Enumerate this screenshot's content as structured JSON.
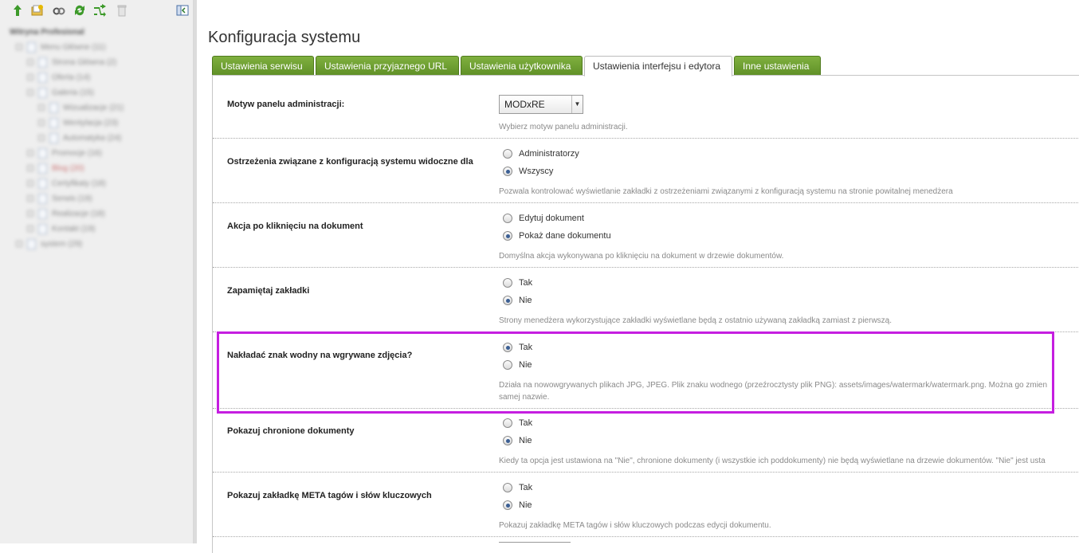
{
  "sidebar": {
    "toolbar_icons": [
      "arrow-up-icon",
      "new-folder-icon",
      "link-icon",
      "refresh-icon",
      "shuffle-icon",
      "trash-icon",
      "collapse-panel-icon"
    ],
    "tree": [
      {
        "label": "Witryna Profesional",
        "level": 0,
        "root": true
      },
      {
        "label": "Menu Główne (11)",
        "level": 1
      },
      {
        "label": "Strona Główna (2)",
        "level": 2
      },
      {
        "label": "Oferta (14)",
        "level": 2
      },
      {
        "label": "Galeria (15)",
        "level": 2
      },
      {
        "label": "Wizualizacje (21)",
        "level": 3
      },
      {
        "label": "Wentylacja (23)",
        "level": 3
      },
      {
        "label": "Automatyka (24)",
        "level": 3
      },
      {
        "label": "Promocje (16)",
        "level": 2
      },
      {
        "label": "Blog (20)",
        "level": 2,
        "red": true
      },
      {
        "label": "Certyfikaty (18)",
        "level": 2
      },
      {
        "label": "Serwis (19)",
        "level": 2
      },
      {
        "label": "Realizacje (18)",
        "level": 2
      },
      {
        "label": "Kontakt (19)",
        "level": 2
      },
      {
        "label": "system (29)",
        "level": 1
      }
    ]
  },
  "page": {
    "title": "Konfiguracja systemu"
  },
  "tabs": [
    {
      "label": "Ustawienia serwisu",
      "active": false
    },
    {
      "label": "Ustawienia przyjaznego URL",
      "active": false
    },
    {
      "label": "Ustawienia użytkownika",
      "active": false
    },
    {
      "label": "Ustawienia interfejsu i edytora",
      "active": true
    },
    {
      "label": "Inne ustawienia",
      "active": false
    }
  ],
  "settings": {
    "theme": {
      "label": "Motyw panelu administracji:",
      "selected": "MODxRE",
      "description": "Wybierz motyw panelu administracji."
    },
    "warnings": {
      "label": "Ostrzeżenia związane z konfiguracją systemu widoczne dla",
      "options": [
        {
          "label": "Administratorzy",
          "checked": false
        },
        {
          "label": "Wszyscy",
          "checked": true
        }
      ],
      "description": "Pozwala kontrolować wyświetlanie zakładki z ostrzeżeniami związanymi z konfiguracją systemu na stronie powitalnej menedżera"
    },
    "doc_click": {
      "label": "Akcja po kliknięciu na dokument",
      "options": [
        {
          "label": "Edytuj dokument",
          "checked": false
        },
        {
          "label": "Pokaż dane dokumentu",
          "checked": true
        }
      ],
      "description": "Domyślna akcja wykonywana po kliknięciu na dokument w drzewie dokumentów."
    },
    "remember_tabs": {
      "label": "Zapamiętaj zakładki",
      "options": [
        {
          "label": "Tak",
          "checked": false
        },
        {
          "label": "Nie",
          "checked": true
        }
      ],
      "description": "Strony menedżera wykorzystujące zakładki wyświetlane będą z ostatnio używaną zakładką zamiast z pierwszą."
    },
    "watermark": {
      "label": "Nakładać znak wodny na wgrywane zdjęcia?",
      "options": [
        {
          "label": "Tak",
          "checked": true
        },
        {
          "label": "Nie",
          "checked": false
        }
      ],
      "description_line1": "Działa na nowowgrywanych plikach JPG, JPEG. Plik znaku wodnego (przeźrocztysty plik PNG): assets/images/watermark/watermark.png. Można go zmien",
      "description_line2": "samej nazwie."
    },
    "protected_docs": {
      "label": "Pokazuj chronione dokumenty",
      "options": [
        {
          "label": "Tak",
          "checked": false
        },
        {
          "label": "Nie",
          "checked": true
        }
      ],
      "description": "Kiedy ta opcja jest ustawiona na \"Nie\", chronione dokumenty (i wszystkie ich poddokumenty) nie będą wyświetlane na drzewie dokumentów. \"Nie\" jest usta"
    },
    "meta_tab": {
      "label": "Pokazuj zakładkę META tagów i słów kluczowych",
      "options": [
        {
          "label": "Tak",
          "checked": false
        },
        {
          "label": "Nie",
          "checked": true
        }
      ],
      "description": "Pokazuj zakładkę META tagów i słów kluczowych podczas edycji dokumentu."
    }
  },
  "colors": {
    "tab_green": "#6a9a2e",
    "highlight": "#c51ee0",
    "radio_dot": "#3b5f94"
  }
}
